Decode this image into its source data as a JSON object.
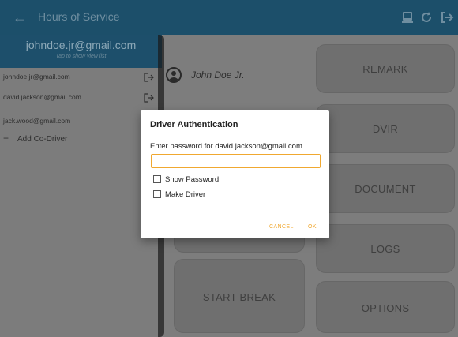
{
  "appbar": {
    "title": "Hours of Service",
    "icons": [
      "back-arrow-icon",
      "device-icon",
      "refresh-icon",
      "logout-icon"
    ]
  },
  "drawer": {
    "header_email": "johndoe.jr@gmail.com",
    "header_hint": "Tap to show view list",
    "accounts": [
      {
        "email": "johndoe.jr@gmail.com",
        "icon": "logout-icon"
      },
      {
        "email": "david.jackson@gmail.com",
        "icon": "logout-icon"
      },
      {
        "email": "jack.wood@gmail.com"
      }
    ],
    "add_label": "Add Co-Driver",
    "add_icon": "plus-icon"
  },
  "main": {
    "driver_name": "John Doe Jr.",
    "tiles": [
      "REMARK",
      "DVIR",
      "DOCUMENT",
      "LOGS",
      "START BREAK",
      "OPTIONS"
    ]
  },
  "dialog": {
    "title": "Driver Authentication",
    "prompt": "Enter password for david.jackson@gmail.com",
    "password_value": "",
    "show_password_label": "Show Password",
    "make_driver_label": "Make Driver",
    "cancel_label": "CANCEL",
    "ok_label": "OK"
  },
  "colors": {
    "appbar": "#1c4f6a",
    "accent": "#f0a830",
    "overlay": "#7d7d7d"
  }
}
